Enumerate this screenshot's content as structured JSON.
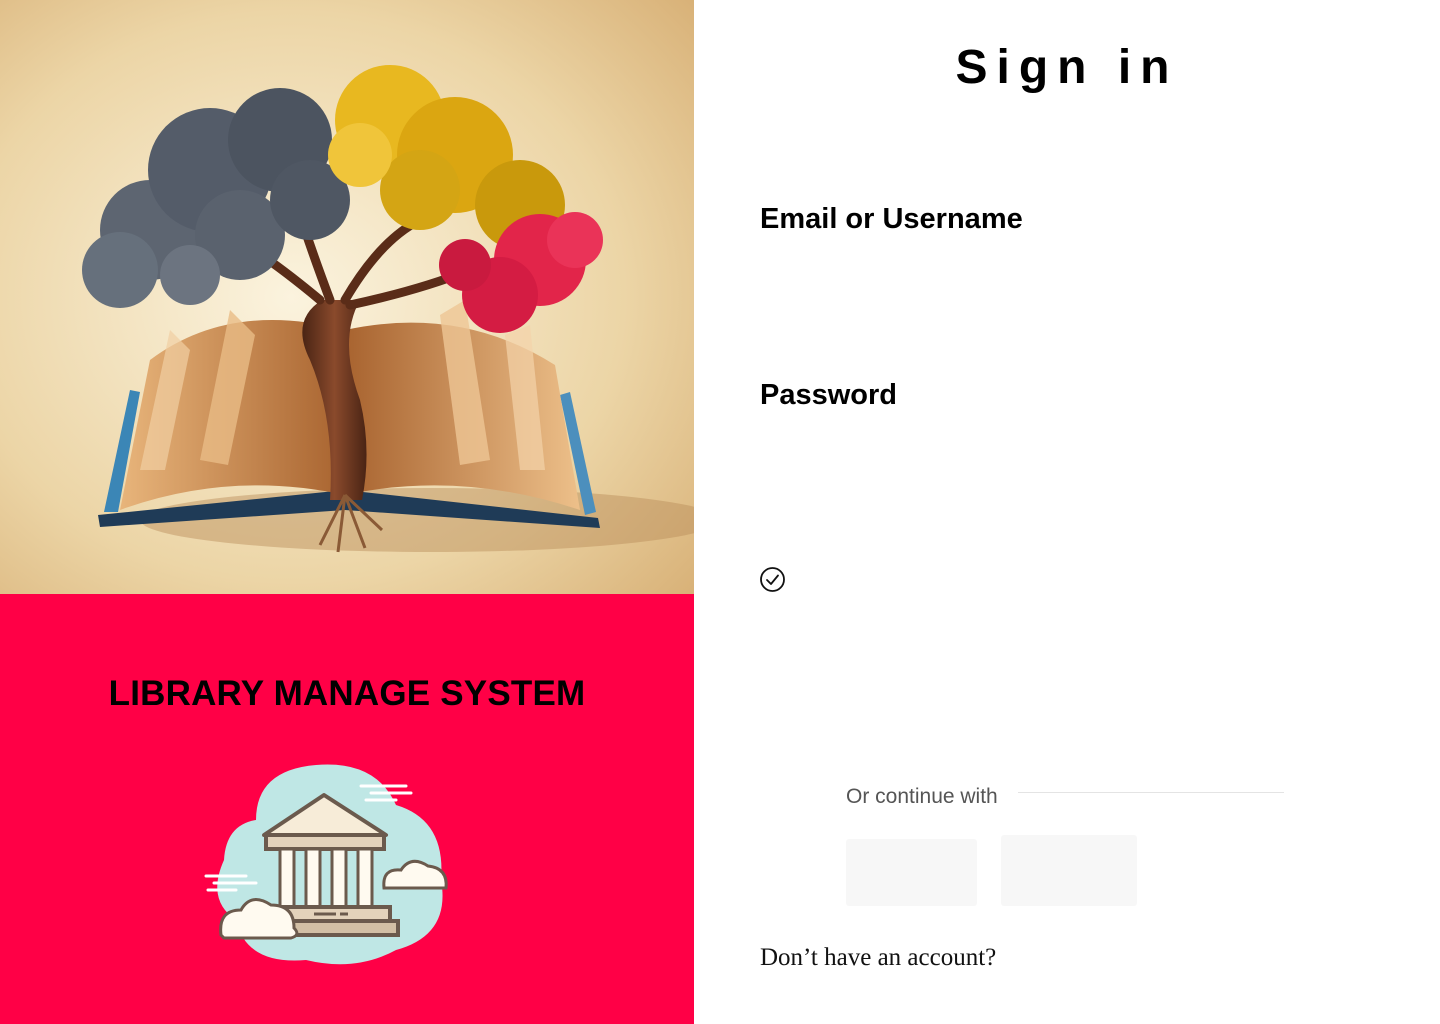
{
  "brand": {
    "title": "LIBRARY MANAGE SYSTEM",
    "panel_color": "#FF0046"
  },
  "signin": {
    "title": "Sign in",
    "email_label": "Email or Username",
    "email_value": "",
    "password_label": "Password",
    "password_value": "",
    "divider_text": "Or continue with",
    "signup_prompt": "Don’t have an account?"
  },
  "icons": {
    "remember": "check-circle-icon",
    "hero": "book-tree-illustration",
    "building": "library-building-icon"
  }
}
